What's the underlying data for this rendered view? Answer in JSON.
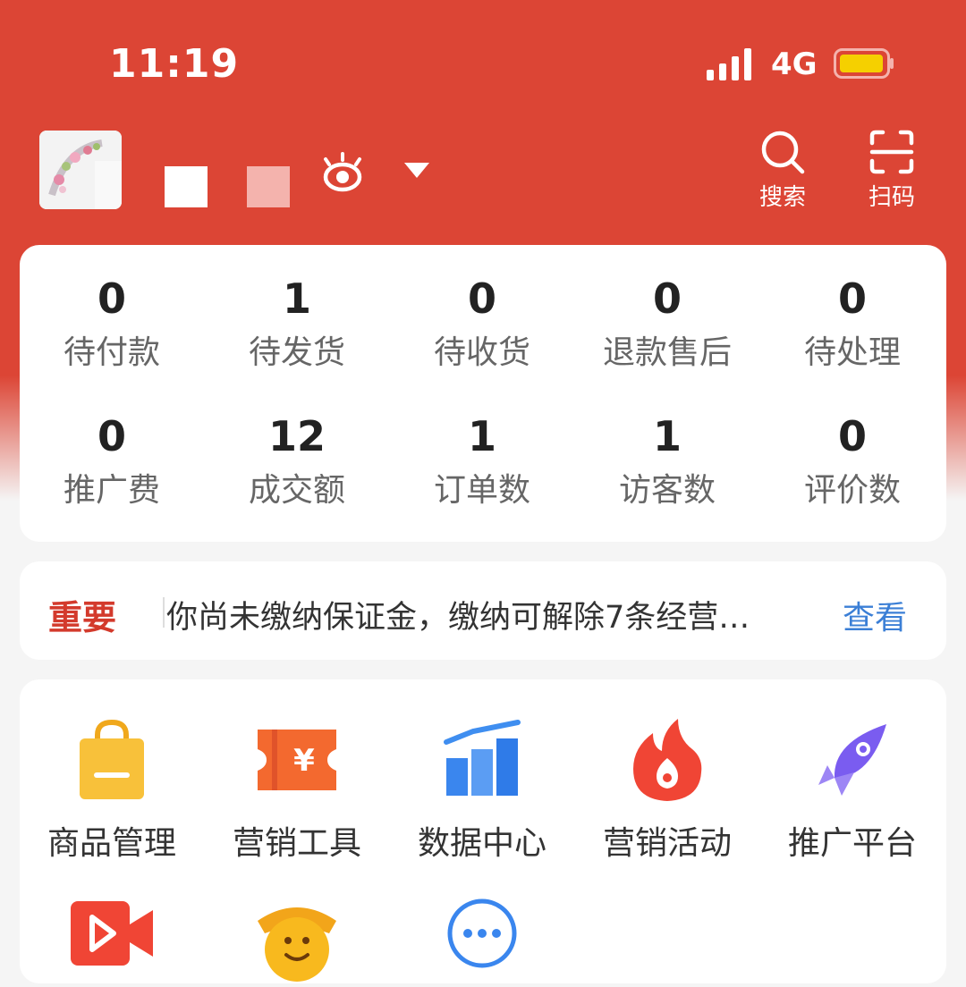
{
  "status_bar": {
    "time": "11:19",
    "network": "4G"
  },
  "header": {
    "search_label": "搜索",
    "scan_label": "扫码"
  },
  "stats_row1": [
    {
      "value": "0",
      "label": "待付款"
    },
    {
      "value": "1",
      "label": "待发货"
    },
    {
      "value": "0",
      "label": "待收货"
    },
    {
      "value": "0",
      "label": "退款售后"
    },
    {
      "value": "0",
      "label": "待处理"
    }
  ],
  "stats_row2": [
    {
      "value": "0",
      "label": "推广费"
    },
    {
      "value": "12",
      "label": "成交额"
    },
    {
      "value": "1",
      "label": "订单数"
    },
    {
      "value": "1",
      "label": "访客数"
    },
    {
      "value": "0",
      "label": "评价数"
    }
  ],
  "notice": {
    "tag": "重要",
    "message": "你尚未缴纳保证金，缴纳可解除7条经营…",
    "link": "查看"
  },
  "tools": [
    {
      "label": "商品管理",
      "icon": "shopping-bag-icon"
    },
    {
      "label": "营销工具",
      "icon": "coupon-ticket-icon"
    },
    {
      "label": "数据中心",
      "icon": "bar-chart-icon"
    },
    {
      "label": "营销活动",
      "icon": "flame-icon"
    },
    {
      "label": "推广平台",
      "icon": "rocket-icon"
    },
    {
      "label": "",
      "icon": "video-play-icon"
    },
    {
      "label": "",
      "icon": "smiley-mascot-icon"
    },
    {
      "label": "",
      "icon": "more-dots-icon"
    }
  ],
  "colors": {
    "brand_red": "#dc4535",
    "notice_tag": "#d33a2c",
    "link_blue": "#3b7fd6",
    "battery_fill": "#f5d000"
  }
}
